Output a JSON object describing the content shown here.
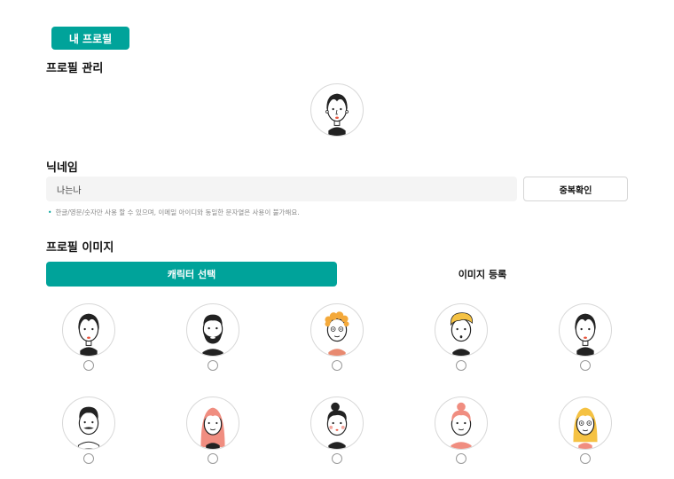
{
  "header": {
    "badge": "내 프로필"
  },
  "profile": {
    "section_title": "프로필 관리",
    "avatar_icon": "character-woman-black-hair-icon"
  },
  "nickname": {
    "label": "닉네임",
    "value": "나는나",
    "check_button": "중복확인",
    "hint": "한글/영문/숫자만 사용 할 수 있으며, 이메일 아이디와 동일한 문자열은 사용이 불가해요."
  },
  "profile_image": {
    "label": "프로필 이미지",
    "tabs": [
      {
        "label": "캐릭터 선택",
        "active": true
      },
      {
        "label": "이미지 등록",
        "active": false
      }
    ]
  },
  "colors": {
    "accent": "#00a39a"
  },
  "characters": [
    {
      "icon": "woman-black-hair-icon"
    },
    {
      "icon": "man-beard-icon"
    },
    {
      "icon": "curly-orange-hair-icon"
    },
    {
      "icon": "blond-man-icon"
    },
    {
      "icon": "woman-black-hair-icon"
    },
    {
      "icon": "man-mustache-icon"
    },
    {
      "icon": "woman-pink-long-hair-icon"
    },
    {
      "icon": "woman-black-bun-icon"
    },
    {
      "icon": "woman-pink-bun-icon"
    },
    {
      "icon": "woman-blond-glasses-icon"
    }
  ]
}
